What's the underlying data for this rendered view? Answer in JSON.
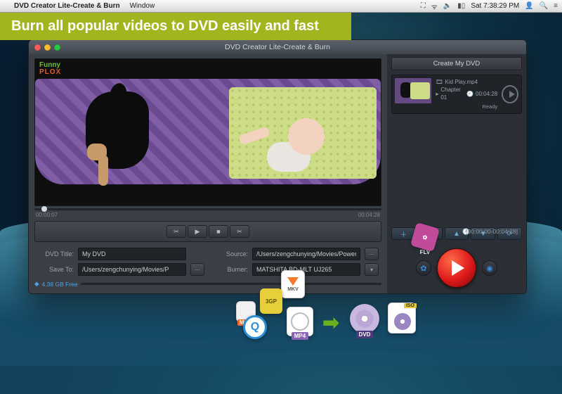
{
  "menubar": {
    "app_name": "DVD Creator Lite-Create & Burn",
    "menu_window": "Window",
    "clock": "Sat 7:38:29 PM"
  },
  "banner": "Burn all popular videos to DVD easily and fast",
  "window": {
    "title": "DVD Creator Lite-Create & Burn"
  },
  "preview": {
    "watermark_line1": "Funny",
    "watermark_line2": "PLOX",
    "elapsed": "00:00:07",
    "total": "00:04:28",
    "range": "[00:00:00-00:04:28]"
  },
  "settings": {
    "title_label": "DVD Title:",
    "title_value": "My DVD",
    "source_label": "Source:",
    "source_value": "/Users/zengchunying/Movies/Power",
    "save_label": "Save To:",
    "save_value": "/Users/zengchunying/Movies/P",
    "burner_label": "Burner:",
    "burner_value": "MATSHITA BD-MLT UJ265",
    "free_space": "4.38 GB Free"
  },
  "sidebar": {
    "header": "Create My DVD",
    "clip_name": "Kid Play.mp4",
    "chapter": "Chapter 01",
    "duration": "00:04:28",
    "ready": "Ready"
  },
  "formats": {
    "flv": "FLV",
    "mkv": "MKV",
    "tgp": "3GP",
    "mov": "MOV",
    "qt": "Q",
    "mp4": "MP4",
    "dvd": "DVD",
    "iso": "ISO"
  }
}
